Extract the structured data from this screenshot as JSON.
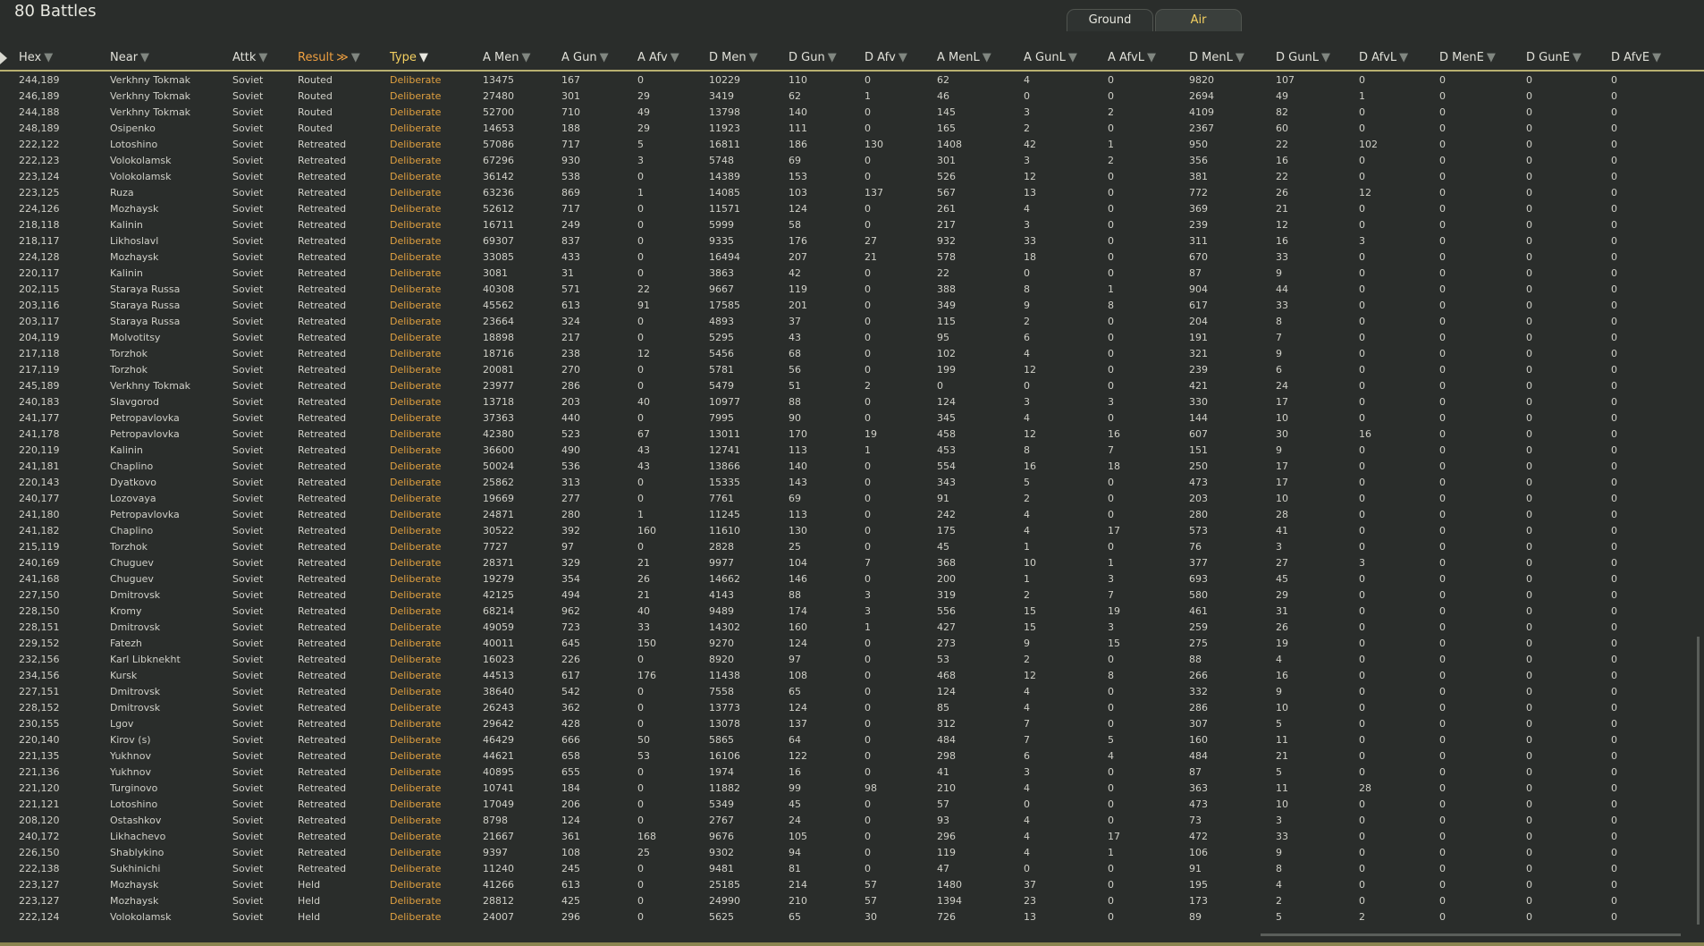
{
  "title": "80 Battles",
  "tabs": [
    "Ground",
    "Air"
  ],
  "columns": [
    "Hex",
    "Near",
    "Attk",
    "Result",
    "Type",
    "A Men",
    "A Gun",
    "A Afv",
    "D Men",
    "D Gun",
    "D Afv",
    "A MenL",
    "A GunL",
    "A AfvL",
    "D MenL",
    "D GunL",
    "D AfvL",
    "D MenE",
    "D GunE",
    "D AfvE"
  ],
  "sort_indicator": "≫",
  "rows": [
    [
      "244,189",
      "Verkhny Tokmak",
      "Soviet",
      "Routed",
      "Deliberate",
      "13475",
      "167",
      "0",
      "10229",
      "110",
      "0",
      "62",
      "4",
      "0",
      "9820",
      "107",
      "0",
      "0",
      "0",
      "0"
    ],
    [
      "246,189",
      "Verkhny Tokmak",
      "Soviet",
      "Routed",
      "Deliberate",
      "27480",
      "301",
      "29",
      "3419",
      "62",
      "1",
      "46",
      "0",
      "0",
      "2694",
      "49",
      "1",
      "0",
      "0",
      "0"
    ],
    [
      "244,188",
      "Verkhny Tokmak",
      "Soviet",
      "Routed",
      "Deliberate",
      "52700",
      "710",
      "49",
      "13798",
      "140",
      "0",
      "145",
      "3",
      "2",
      "4109",
      "82",
      "0",
      "0",
      "0",
      "0"
    ],
    [
      "248,189",
      "Osipenko",
      "Soviet",
      "Routed",
      "Deliberate",
      "14653",
      "188",
      "29",
      "11923",
      "111",
      "0",
      "165",
      "2",
      "0",
      "2367",
      "60",
      "0",
      "0",
      "0",
      "0"
    ],
    [
      "222,122",
      "Lotoshino",
      "Soviet",
      "Retreated",
      "Deliberate",
      "57086",
      "717",
      "5",
      "16811",
      "186",
      "130",
      "1408",
      "42",
      "1",
      "950",
      "22",
      "102",
      "0",
      "0",
      "0"
    ],
    [
      "222,123",
      "Volokolamsk",
      "Soviet",
      "Retreated",
      "Deliberate",
      "67296",
      "930",
      "3",
      "5748",
      "69",
      "0",
      "301",
      "3",
      "2",
      "356",
      "16",
      "0",
      "0",
      "0",
      "0"
    ],
    [
      "223,124",
      "Volokolamsk",
      "Soviet",
      "Retreated",
      "Deliberate",
      "36142",
      "538",
      "0",
      "14389",
      "153",
      "0",
      "526",
      "12",
      "0",
      "381",
      "22",
      "0",
      "0",
      "0",
      "0"
    ],
    [
      "223,125",
      "Ruza",
      "Soviet",
      "Retreated",
      "Deliberate",
      "63236",
      "869",
      "1",
      "14085",
      "103",
      "137",
      "567",
      "13",
      "0",
      "772",
      "26",
      "12",
      "0",
      "0",
      "0"
    ],
    [
      "224,126",
      "Mozhaysk",
      "Soviet",
      "Retreated",
      "Deliberate",
      "52612",
      "717",
      "0",
      "11571",
      "124",
      "0",
      "261",
      "4",
      "0",
      "369",
      "21",
      "0",
      "0",
      "0",
      "0"
    ],
    [
      "218,118",
      "Kalinin",
      "Soviet",
      "Retreated",
      "Deliberate",
      "16711",
      "249",
      "0",
      "5999",
      "58",
      "0",
      "217",
      "3",
      "0",
      "239",
      "12",
      "0",
      "0",
      "0",
      "0"
    ],
    [
      "218,117",
      "Likhoslavl",
      "Soviet",
      "Retreated",
      "Deliberate",
      "69307",
      "837",
      "0",
      "9335",
      "176",
      "27",
      "932",
      "33",
      "0",
      "311",
      "16",
      "3",
      "0",
      "0",
      "0"
    ],
    [
      "224,128",
      "Mozhaysk",
      "Soviet",
      "Retreated",
      "Deliberate",
      "33085",
      "433",
      "0",
      "16494",
      "207",
      "21",
      "578",
      "18",
      "0",
      "670",
      "33",
      "0",
      "0",
      "0",
      "0"
    ],
    [
      "220,117",
      "Kalinin",
      "Soviet",
      "Retreated",
      "Deliberate",
      "3081",
      "31",
      "0",
      "3863",
      "42",
      "0",
      "22",
      "0",
      "0",
      "87",
      "9",
      "0",
      "0",
      "0",
      "0"
    ],
    [
      "202,115",
      "Staraya Russa",
      "Soviet",
      "Retreated",
      "Deliberate",
      "40308",
      "571",
      "22",
      "9667",
      "119",
      "0",
      "388",
      "8",
      "1",
      "904",
      "44",
      "0",
      "0",
      "0",
      "0"
    ],
    [
      "203,116",
      "Staraya Russa",
      "Soviet",
      "Retreated",
      "Deliberate",
      "45562",
      "613",
      "91",
      "17585",
      "201",
      "0",
      "349",
      "9",
      "8",
      "617",
      "33",
      "0",
      "0",
      "0",
      "0"
    ],
    [
      "203,117",
      "Staraya Russa",
      "Soviet",
      "Retreated",
      "Deliberate",
      "23664",
      "324",
      "0",
      "4893",
      "37",
      "0",
      "115",
      "2",
      "0",
      "204",
      "8",
      "0",
      "0",
      "0",
      "0"
    ],
    [
      "204,119",
      "Molvotitsy",
      "Soviet",
      "Retreated",
      "Deliberate",
      "18898",
      "217",
      "0",
      "5295",
      "43",
      "0",
      "95",
      "6",
      "0",
      "191",
      "7",
      "0",
      "0",
      "0",
      "0"
    ],
    [
      "217,118",
      "Torzhok",
      "Soviet",
      "Retreated",
      "Deliberate",
      "18716",
      "238",
      "12",
      "5456",
      "68",
      "0",
      "102",
      "4",
      "0",
      "321",
      "9",
      "0",
      "0",
      "0",
      "0"
    ],
    [
      "217,119",
      "Torzhok",
      "Soviet",
      "Retreated",
      "Deliberate",
      "20081",
      "270",
      "0",
      "5781",
      "56",
      "0",
      "199",
      "12",
      "0",
      "239",
      "6",
      "0",
      "0",
      "0",
      "0"
    ],
    [
      "245,189",
      "Verkhny Tokmak",
      "Soviet",
      "Retreated",
      "Deliberate",
      "23977",
      "286",
      "0",
      "5479",
      "51",
      "2",
      "0",
      "0",
      "0",
      "421",
      "24",
      "0",
      "0",
      "0",
      "0"
    ],
    [
      "240,183",
      "Slavgorod",
      "Soviet",
      "Retreated",
      "Deliberate",
      "13718",
      "203",
      "40",
      "10977",
      "88",
      "0",
      "124",
      "3",
      "3",
      "330",
      "17",
      "0",
      "0",
      "0",
      "0"
    ],
    [
      "241,177",
      "Petropavlovka",
      "Soviet",
      "Retreated",
      "Deliberate",
      "37363",
      "440",
      "0",
      "7995",
      "90",
      "0",
      "345",
      "4",
      "0",
      "144",
      "10",
      "0",
      "0",
      "0",
      "0"
    ],
    [
      "241,178",
      "Petropavlovka",
      "Soviet",
      "Retreated",
      "Deliberate",
      "42380",
      "523",
      "67",
      "13011",
      "170",
      "19",
      "458",
      "12",
      "16",
      "607",
      "30",
      "16",
      "0",
      "0",
      "0"
    ],
    [
      "220,119",
      "Kalinin",
      "Soviet",
      "Retreated",
      "Deliberate",
      "36600",
      "490",
      "43",
      "12741",
      "113",
      "1",
      "453",
      "8",
      "7",
      "151",
      "9",
      "0",
      "0",
      "0",
      "0"
    ],
    [
      "241,181",
      "Chaplino",
      "Soviet",
      "Retreated",
      "Deliberate",
      "50024",
      "536",
      "43",
      "13866",
      "140",
      "0",
      "554",
      "16",
      "18",
      "250",
      "17",
      "0",
      "0",
      "0",
      "0"
    ],
    [
      "220,143",
      "Dyatkovo",
      "Soviet",
      "Retreated",
      "Deliberate",
      "25862",
      "313",
      "0",
      "15335",
      "143",
      "0",
      "343",
      "5",
      "0",
      "473",
      "17",
      "0",
      "0",
      "0",
      "0"
    ],
    [
      "240,177",
      "Lozovaya",
      "Soviet",
      "Retreated",
      "Deliberate",
      "19669",
      "277",
      "0",
      "7761",
      "69",
      "0",
      "91",
      "2",
      "0",
      "203",
      "10",
      "0",
      "0",
      "0",
      "0"
    ],
    [
      "241,180",
      "Petropavlovka",
      "Soviet",
      "Retreated",
      "Deliberate",
      "24871",
      "280",
      "1",
      "11245",
      "113",
      "0",
      "242",
      "4",
      "0",
      "280",
      "28",
      "0",
      "0",
      "0",
      "0"
    ],
    [
      "241,182",
      "Chaplino",
      "Soviet",
      "Retreated",
      "Deliberate",
      "30522",
      "392",
      "160",
      "11610",
      "130",
      "0",
      "175",
      "4",
      "17",
      "573",
      "41",
      "0",
      "0",
      "0",
      "0"
    ],
    [
      "215,119",
      "Torzhok",
      "Soviet",
      "Retreated",
      "Deliberate",
      "7727",
      "97",
      "0",
      "2828",
      "25",
      "0",
      "45",
      "1",
      "0",
      "76",
      "3",
      "0",
      "0",
      "0",
      "0"
    ],
    [
      "240,169",
      "Chuguev",
      "Soviet",
      "Retreated",
      "Deliberate",
      "28371",
      "329",
      "21",
      "9977",
      "104",
      "7",
      "368",
      "10",
      "1",
      "377",
      "27",
      "3",
      "0",
      "0",
      "0"
    ],
    [
      "241,168",
      "Chuguev",
      "Soviet",
      "Retreated",
      "Deliberate",
      "19279",
      "354",
      "26",
      "14662",
      "146",
      "0",
      "200",
      "1",
      "3",
      "693",
      "45",
      "0",
      "0",
      "0",
      "0"
    ],
    [
      "227,150",
      "Dmitrovsk",
      "Soviet",
      "Retreated",
      "Deliberate",
      "42125",
      "494",
      "21",
      "4143",
      "88",
      "3",
      "319",
      "2",
      "7",
      "580",
      "29",
      "0",
      "0",
      "0",
      "0"
    ],
    [
      "228,150",
      "Kromy",
      "Soviet",
      "Retreated",
      "Deliberate",
      "68214",
      "962",
      "40",
      "9489",
      "174",
      "3",
      "556",
      "15",
      "19",
      "461",
      "31",
      "0",
      "0",
      "0",
      "0"
    ],
    [
      "228,151",
      "Dmitrovsk",
      "Soviet",
      "Retreated",
      "Deliberate",
      "49059",
      "723",
      "33",
      "14302",
      "160",
      "1",
      "427",
      "15",
      "3",
      "259",
      "26",
      "0",
      "0",
      "0",
      "0"
    ],
    [
      "229,152",
      "Fatezh",
      "Soviet",
      "Retreated",
      "Deliberate",
      "40011",
      "645",
      "150",
      "9270",
      "124",
      "0",
      "273",
      "9",
      "15",
      "275",
      "19",
      "0",
      "0",
      "0",
      "0"
    ],
    [
      "232,156",
      "Karl Libknekht",
      "Soviet",
      "Retreated",
      "Deliberate",
      "16023",
      "226",
      "0",
      "8920",
      "97",
      "0",
      "53",
      "2",
      "0",
      "88",
      "4",
      "0",
      "0",
      "0",
      "0"
    ],
    [
      "234,156",
      "Kursk",
      "Soviet",
      "Retreated",
      "Deliberate",
      "44513",
      "617",
      "176",
      "11438",
      "108",
      "0",
      "468",
      "12",
      "8",
      "266",
      "16",
      "0",
      "0",
      "0",
      "0"
    ],
    [
      "227,151",
      "Dmitrovsk",
      "Soviet",
      "Retreated",
      "Deliberate",
      "38640",
      "542",
      "0",
      "7558",
      "65",
      "0",
      "124",
      "4",
      "0",
      "332",
      "9",
      "0",
      "0",
      "0",
      "0"
    ],
    [
      "228,152",
      "Dmitrovsk",
      "Soviet",
      "Retreated",
      "Deliberate",
      "26243",
      "362",
      "0",
      "13773",
      "124",
      "0",
      "85",
      "4",
      "0",
      "286",
      "10",
      "0",
      "0",
      "0",
      "0"
    ],
    [
      "230,155",
      "Lgov",
      "Soviet",
      "Retreated",
      "Deliberate",
      "29642",
      "428",
      "0",
      "13078",
      "137",
      "0",
      "312",
      "7",
      "0",
      "307",
      "5",
      "0",
      "0",
      "0",
      "0"
    ],
    [
      "220,140",
      "Kirov (s)",
      "Soviet",
      "Retreated",
      "Deliberate",
      "46429",
      "666",
      "50",
      "5865",
      "64",
      "0",
      "484",
      "7",
      "5",
      "160",
      "11",
      "0",
      "0",
      "0",
      "0"
    ],
    [
      "221,135",
      "Yukhnov",
      "Soviet",
      "Retreated",
      "Deliberate",
      "44621",
      "658",
      "53",
      "16106",
      "122",
      "0",
      "298",
      "6",
      "4",
      "484",
      "21",
      "0",
      "0",
      "0",
      "0"
    ],
    [
      "221,136",
      "Yukhnov",
      "Soviet",
      "Retreated",
      "Deliberate",
      "40895",
      "655",
      "0",
      "1974",
      "16",
      "0",
      "41",
      "3",
      "0",
      "87",
      "5",
      "0",
      "0",
      "0",
      "0"
    ],
    [
      "221,120",
      "Turginovo",
      "Soviet",
      "Retreated",
      "Deliberate",
      "10741",
      "184",
      "0",
      "11882",
      "99",
      "98",
      "210",
      "4",
      "0",
      "363",
      "11",
      "28",
      "0",
      "0",
      "0"
    ],
    [
      "221,121",
      "Lotoshino",
      "Soviet",
      "Retreated",
      "Deliberate",
      "17049",
      "206",
      "0",
      "5349",
      "45",
      "0",
      "57",
      "0",
      "0",
      "473",
      "10",
      "0",
      "0",
      "0",
      "0"
    ],
    [
      "208,120",
      "Ostashkov",
      "Soviet",
      "Retreated",
      "Deliberate",
      "8798",
      "124",
      "0",
      "2767",
      "24",
      "0",
      "93",
      "4",
      "0",
      "73",
      "3",
      "0",
      "0",
      "0",
      "0"
    ],
    [
      "240,172",
      "Likhachevo",
      "Soviet",
      "Retreated",
      "Deliberate",
      "21667",
      "361",
      "168",
      "9676",
      "105",
      "0",
      "296",
      "4",
      "17",
      "472",
      "33",
      "0",
      "0",
      "0",
      "0"
    ],
    [
      "226,150",
      "Shablykino",
      "Soviet",
      "Retreated",
      "Deliberate",
      "9397",
      "108",
      "25",
      "9302",
      "94",
      "0",
      "119",
      "4",
      "1",
      "106",
      "9",
      "0",
      "0",
      "0",
      "0"
    ],
    [
      "222,138",
      "Sukhinichi",
      "Soviet",
      "Retreated",
      "Deliberate",
      "11240",
      "245",
      "0",
      "9481",
      "81",
      "0",
      "47",
      "0",
      "0",
      "91",
      "8",
      "0",
      "0",
      "0",
      "0"
    ],
    [
      "223,127",
      "Mozhaysk",
      "Soviet",
      "Held",
      "Deliberate",
      "41266",
      "613",
      "0",
      "25185",
      "214",
      "57",
      "1480",
      "37",
      "0",
      "195",
      "4",
      "0",
      "0",
      "0",
      "0"
    ],
    [
      "223,127",
      "Mozhaysk",
      "Soviet",
      "Held",
      "Deliberate",
      "28812",
      "425",
      "0",
      "24990",
      "210",
      "57",
      "1394",
      "23",
      "0",
      "173",
      "2",
      "0",
      "0",
      "0",
      "0"
    ],
    [
      "222,124",
      "Volokolamsk",
      "Soviet",
      "Held",
      "Deliberate",
      "24007",
      "296",
      "0",
      "5625",
      "65",
      "30",
      "726",
      "13",
      "0",
      "89",
      "5",
      "2",
      "0",
      "0",
      "0"
    ]
  ]
}
